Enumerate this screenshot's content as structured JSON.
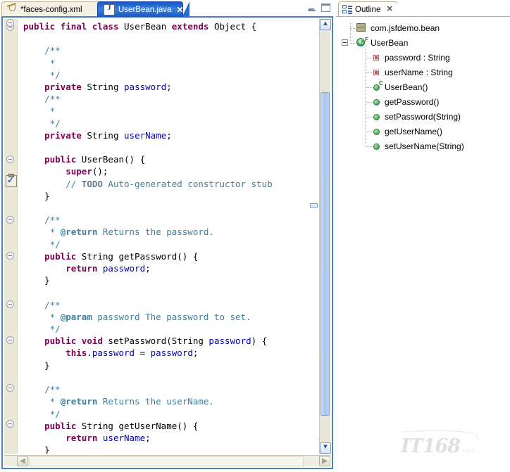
{
  "editor": {
    "tabs": [
      {
        "label": "*faces-config.xml",
        "icon": "jsf-file-icon",
        "active": false
      },
      {
        "label": "UserBean.java",
        "icon": "java-file-icon",
        "active": true,
        "close_label": "✕"
      }
    ],
    "window_controls": {
      "minimize": "minimize-icon",
      "maximize": "maximize-icon"
    },
    "gutter": {
      "task_icon": "todo-task-icon"
    },
    "code": {
      "language": "java",
      "lines": [
        "public final class UserBean extends Object {",
        "",
        "    /**",
        "     *",
        "     */",
        "    private String password;",
        "    /**",
        "     *",
        "     */",
        "    private String userName;",
        "",
        "    public UserBean() {",
        "        super();",
        "        // TODO Auto-generated constructor stub",
        "    }",
        "",
        "    /**",
        "     * @return Returns the password.",
        "     */",
        "    public String getPassword() {",
        "        return password;",
        "    }",
        "",
        "    /**",
        "     * @param password The password to set.",
        "     */",
        "    public void setPassword(String password) {",
        "        this.password = password;",
        "    }",
        "",
        "    /**",
        "     * @return Returns the userName.",
        "     */",
        "    public String getUserName() {",
        "        return userName;",
        "    }"
      ]
    },
    "scrollbars": {
      "vertical_up": "▲",
      "vertical_down": "▼",
      "horizontal_left": "◀",
      "horizontal_right": "▶"
    }
  },
  "outline": {
    "tab": {
      "label": "Outline",
      "icon": "outline-icon",
      "close_label": "✕"
    },
    "tree": [
      {
        "label": "com.jsfdemo.bean",
        "kind": "package",
        "depth": 0
      },
      {
        "label": "UserBean",
        "kind": "class",
        "modifier": "F",
        "depth": 0,
        "expanded": true
      },
      {
        "label": "password : String",
        "kind": "field-private",
        "depth": 1
      },
      {
        "label": "userName : String",
        "kind": "field-private",
        "depth": 1
      },
      {
        "label": "UserBean()",
        "kind": "method-public",
        "modifier": "C",
        "depth": 1
      },
      {
        "label": "getPassword()",
        "kind": "method-public",
        "depth": 1
      },
      {
        "label": "setPassword(String)",
        "kind": "method-public",
        "depth": 1
      },
      {
        "label": "getUserName()",
        "kind": "method-public",
        "depth": 1
      },
      {
        "label": "setUserName(String)",
        "kind": "method-public",
        "depth": 1
      }
    ]
  },
  "watermark": {
    "text": "IT168",
    "suffix": ".com"
  },
  "colors": {
    "keyword": "#7f0055",
    "comment": "#3f7f9f",
    "field": "#0000c0",
    "todo": "#607c8a",
    "active_tab": "#2a68cf",
    "frame_border": "#4a82c8",
    "gutter_bg": "#ece8d8"
  }
}
